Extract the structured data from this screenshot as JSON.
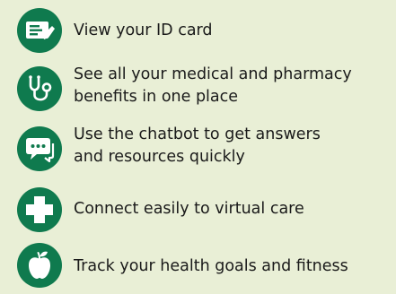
{
  "colors": {
    "background": "#e9efd6",
    "icon_badge": "#0f7a4e",
    "icon_glyph": "#ffffff",
    "text": "#1a1a1a"
  },
  "features": [
    {
      "icon": "id-card-icon",
      "lines": [
        "View your ID card"
      ]
    },
    {
      "icon": "stethoscope-icon",
      "lines": [
        "See all your medical and pharmacy",
        "benefits in one place"
      ]
    },
    {
      "icon": "chatbot-icon",
      "lines": [
        "Use the chatbot to get answers",
        "and resources quickly"
      ]
    },
    {
      "icon": "medical-cross-icon",
      "lines": [
        "Connect easily to virtual care"
      ]
    },
    {
      "icon": "apple-icon",
      "lines": [
        "Track your health goals and fitness"
      ]
    }
  ]
}
